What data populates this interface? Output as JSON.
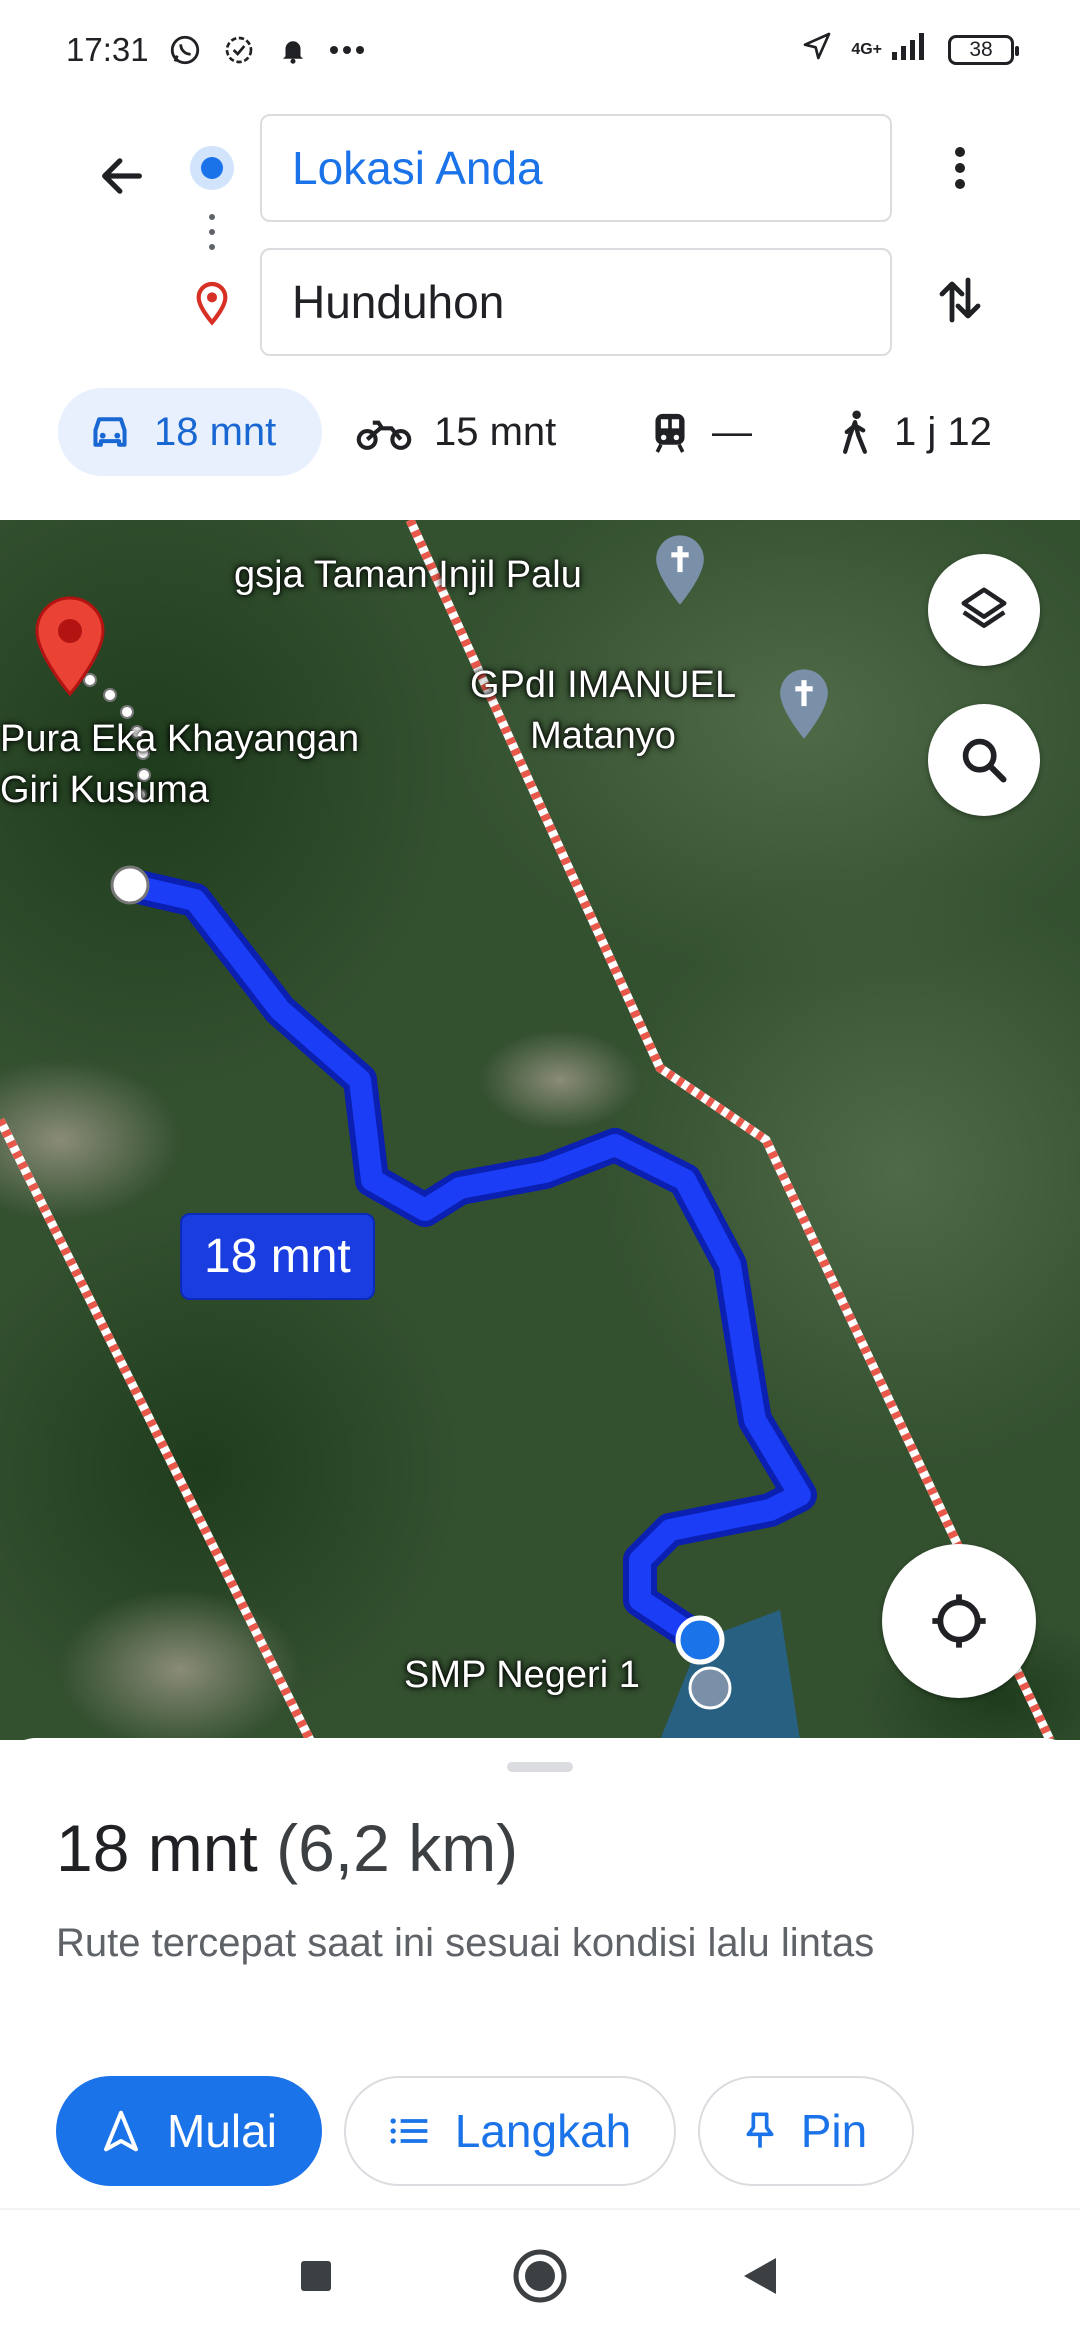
{
  "status_bar": {
    "time": "17:31",
    "network": "4G+",
    "battery": "38",
    "icons": [
      "whatsapp-icon",
      "badge-check-icon",
      "bell-icon",
      "more-dots-icon",
      "location-arrow-icon",
      "signal-icon"
    ]
  },
  "header": {
    "origin": "Lokasi Anda",
    "destination": "Hunduhon"
  },
  "modes": [
    {
      "icon": "car-icon",
      "label": "18 mnt",
      "active": true
    },
    {
      "icon": "motorcycle-icon",
      "label": "15 mnt",
      "active": false
    },
    {
      "icon": "train-icon",
      "label": "—",
      "active": false
    },
    {
      "icon": "walk-icon",
      "label": "1 j 12",
      "active": false
    }
  ],
  "map": {
    "labels": {
      "church1": "gsja Taman Injil Palu",
      "church2_line1": "GPdI IMANUEL",
      "church2_line2": "Matanyo",
      "temple_line1": "Pura Eka Khayangan",
      "temple_line2": "Giri Kusuma",
      "school": "SMP Negeri 1"
    },
    "route_badge": "18 mnt",
    "colors": {
      "route": "#1a3df5",
      "route_outline": "#0b1fb0",
      "pin": "#ea4335",
      "boundary": "#e8584b"
    }
  },
  "sheet": {
    "duration": "18 mnt",
    "distance": "(6,2 km)",
    "subtitle": "Rute tercepat saat ini sesuai kondisi lalu lintas",
    "buttons": {
      "start": "Mulai",
      "steps": "Langkah",
      "pin": "Pin"
    }
  },
  "accent": "#1a73e8"
}
